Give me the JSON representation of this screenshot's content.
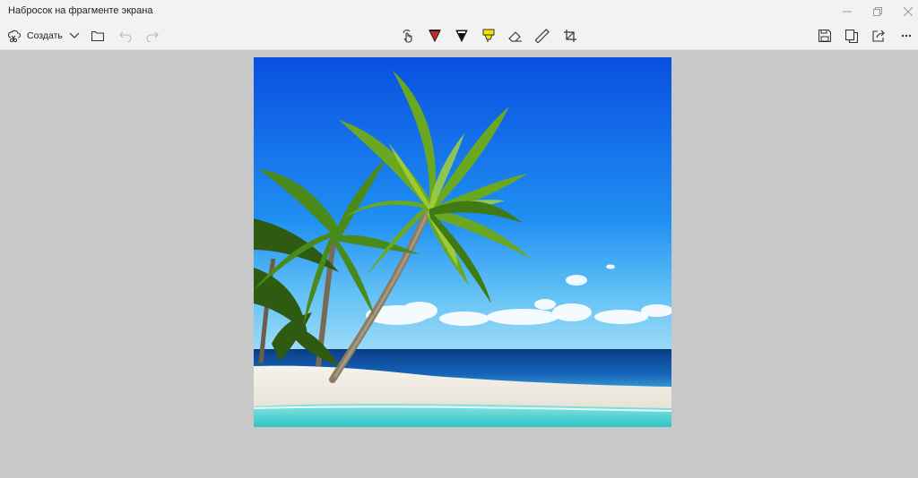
{
  "window": {
    "title": "Набросок на фрагменте экрана"
  },
  "toolbar": {
    "create_label": "Создать"
  },
  "icons": {
    "create": "scissors-cloud-icon",
    "dropdown": "chevron-down-icon",
    "open": "folder-icon",
    "undo": "undo-icon",
    "redo": "redo-icon",
    "touch": "touch-writing-icon",
    "pen_red": "ballpoint-pen-icon",
    "pen_black": "pencil-icon",
    "highlighter": "highlighter-icon",
    "eraser": "eraser-icon",
    "ruler": "ruler-icon",
    "crop": "crop-icon",
    "save": "save-icon",
    "copy": "copy-icon",
    "share": "share-icon",
    "more": "more-icon",
    "minimize": "minimize-icon",
    "restore": "restore-icon",
    "close": "close-icon"
  },
  "colors": {
    "accent": "#1a73c8",
    "pen_red": "#c62828",
    "pen_black": "#111111",
    "highlighter": "#f2e600",
    "background": "#c8c8c8"
  }
}
